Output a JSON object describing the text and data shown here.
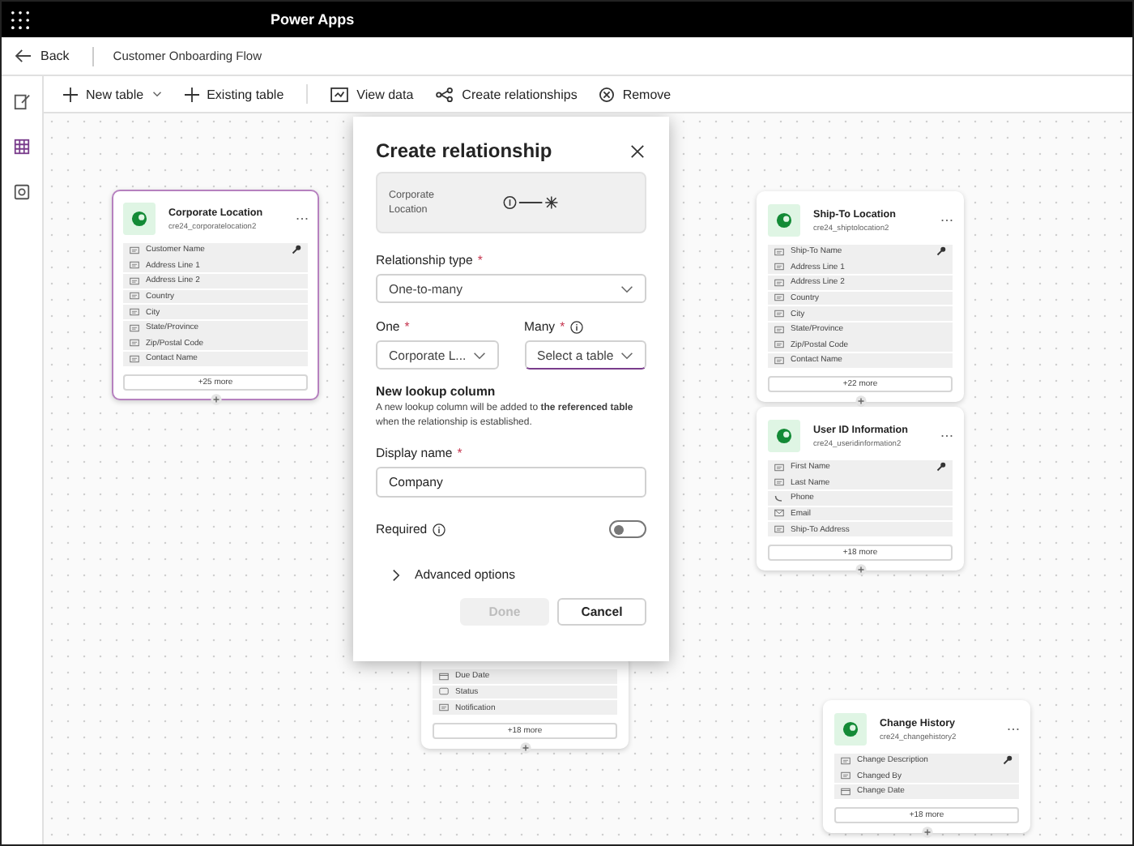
{
  "app_bar": {
    "app_name": "Power Apps"
  },
  "header": {
    "back": "Back",
    "title": "Customer Onboarding Flow"
  },
  "toolbar": [
    {
      "label": "New table",
      "kind": "add",
      "dropdown": true
    },
    {
      "label": "Existing table",
      "kind": "add",
      "dropdown": false
    },
    {
      "label": "View data",
      "kind": "view",
      "dropdown": false
    },
    {
      "label": "Create relationships",
      "kind": "relate",
      "dropdown": false
    },
    {
      "label": "Remove",
      "kind": "remove",
      "dropdown": false
    }
  ],
  "rail": [
    {
      "kind": "edit",
      "selected": false
    },
    {
      "kind": "grid",
      "selected": true
    },
    {
      "kind": "data",
      "selected": false
    }
  ],
  "tables": [
    {
      "title": "Corporate Location",
      "name": "cre24_corporatelocation2",
      "selected": true,
      "more": "+25 more",
      "fields": [
        {
          "label": "Customer Name",
          "kind": "text",
          "key": true
        },
        {
          "label": "Address Line 1",
          "kind": "text",
          "key": false
        },
        {
          "label": "Address Line 2",
          "kind": "text",
          "key": false
        },
        {
          "label": "Country",
          "kind": "text",
          "key": false
        },
        {
          "label": "City",
          "kind": "text",
          "key": false
        },
        {
          "label": "State/Province",
          "kind": "text",
          "key": false
        },
        {
          "label": "Zip/Postal Code",
          "kind": "text",
          "key": false
        },
        {
          "label": "Contact Name",
          "kind": "text",
          "key": false
        }
      ]
    },
    {
      "title": "Ship-To Location",
      "name": "cre24_shiptolocation2",
      "selected": false,
      "more": "+22 more",
      "fields": [
        {
          "label": "Ship-To Name",
          "kind": "text",
          "key": true
        },
        {
          "label": "Address Line 1",
          "kind": "text",
          "key": false
        },
        {
          "label": "Address Line 2",
          "kind": "text",
          "key": false
        },
        {
          "label": "Country",
          "kind": "text",
          "key": false
        },
        {
          "label": "City",
          "kind": "text",
          "key": false
        },
        {
          "label": "State/Province",
          "kind": "text",
          "key": false
        },
        {
          "label": "Zip/Postal Code",
          "kind": "text",
          "key": false
        },
        {
          "label": "Contact Name",
          "kind": "text",
          "key": false
        }
      ]
    },
    {
      "title": "User ID Information",
      "name": "cre24_useridinformation2",
      "selected": false,
      "more": "+18 more",
      "fields": [
        {
          "label": "First Name",
          "kind": "text",
          "key": true
        },
        {
          "label": "Last Name",
          "kind": "text",
          "key": false
        },
        {
          "label": "Phone",
          "kind": "phone",
          "key": false
        },
        {
          "label": "Email",
          "kind": "email",
          "key": false
        },
        {
          "label": "Ship-To Address",
          "kind": "text",
          "key": false
        }
      ]
    },
    {
      "selected": false,
      "more": "+18 more",
      "fields": [
        {
          "label": "Due Date",
          "kind": "date",
          "key": false
        },
        {
          "label": "Status",
          "kind": "choice",
          "key": false
        },
        {
          "label": "Notification",
          "kind": "text",
          "key": false
        }
      ]
    },
    {
      "title": "Change History",
      "name": "cre24_changehistory2",
      "selected": false,
      "more": "+18 more",
      "fields": [
        {
          "label": "Change Description",
          "kind": "text",
          "key": true
        },
        {
          "label": "Changed By",
          "kind": "text",
          "key": false
        },
        {
          "label": "Change Date",
          "kind": "date",
          "key": false
        }
      ]
    }
  ],
  "dialog": {
    "title": "Create relationship",
    "preview": {
      "table": "Corporate Location"
    },
    "relationship_type": {
      "label": "Relationship type",
      "required_mark": "*",
      "value": "One-to-many"
    },
    "one": {
      "label": "One",
      "required_mark": "*",
      "value": "Corporate L..."
    },
    "many": {
      "label": "Many",
      "required_mark": "*",
      "placeholder": "Select a table",
      "focused": true
    },
    "lookup": {
      "heading": "New lookup column",
      "description": "A new lookup column will be added to **the referenced table** when the relationship is established."
    },
    "display_name": {
      "label": "Display name",
      "required_mark": "*",
      "value": "Company"
    },
    "required": {
      "label": "Required",
      "on": false
    },
    "advanced": {
      "label": "Advanced options",
      "expanded": false
    },
    "buttons": [
      {
        "label": "Done",
        "disabled": true
      },
      {
        "label": "Cancel",
        "disabled": false
      }
    ]
  }
}
